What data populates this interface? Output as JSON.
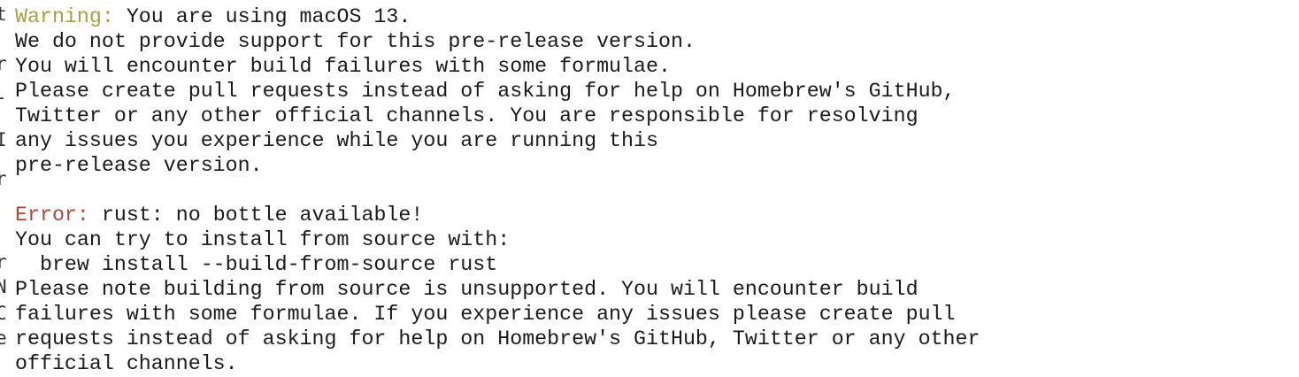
{
  "edge_glyphs": [
    "t",
    "r",
    "-",
    "I",
    "r",
    "r",
    "N",
    "C",
    "e"
  ],
  "warning": {
    "label": "Warning:",
    "message": " You are using macOS 13.",
    "lines": [
      "We do not provide support for this pre-release version.",
      "You will encounter build failures with some formulae.",
      "Please create pull requests instead of asking for help on Homebrew's GitHub,",
      "Twitter or any other official channels. You are responsible for resolving",
      "any issues you experience while you are running this",
      "pre-release version."
    ]
  },
  "error": {
    "label": "Error:",
    "message": " rust: no bottle available!",
    "lines": [
      "You can try to install from source with:",
      "  brew install --build-from-source rust",
      "Please note building from source is unsupported. You will encounter build",
      "failures with some formulae. If you experience any issues please create pull",
      "requests instead of asking for help on Homebrew's GitHub, Twitter or any other",
      "official channels."
    ]
  }
}
